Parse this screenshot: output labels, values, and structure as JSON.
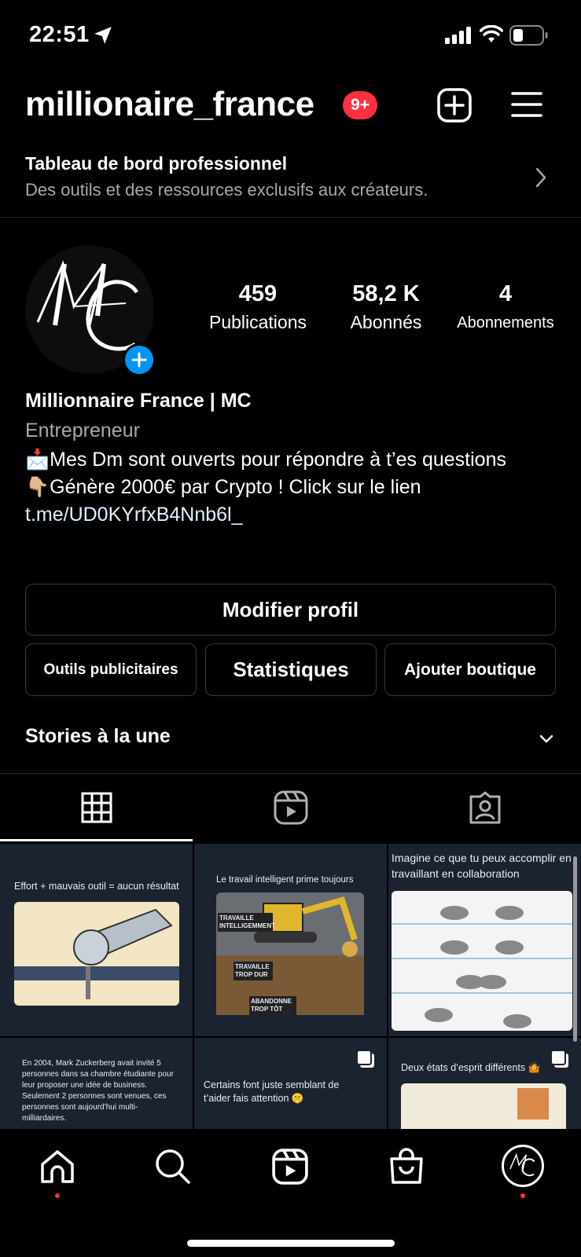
{
  "status_bar": {
    "time": "22:51",
    "icons": [
      "location-arrow-icon",
      "signal-icon",
      "wifi-icon",
      "battery-icon"
    ]
  },
  "header": {
    "username": "millionaire_france",
    "notifications_badge": "9+",
    "icons": [
      "new-post-icon",
      "menu-icon"
    ]
  },
  "dashboard": {
    "title": "Tableau de bord professionnel",
    "subtitle": "Des outils et des ressources exclusifs aux créateurs.",
    "icon": "chevron-right-icon"
  },
  "profile": {
    "avatar_monogram": "MC",
    "stats": [
      {
        "value": "459",
        "label": "Publications"
      },
      {
        "value": "58,2 K",
        "label": "Abonnés"
      },
      {
        "value": "4",
        "label": "Abonnements"
      }
    ],
    "full_name": "Millionnaire France | MC",
    "category": "Entrepreneur",
    "bio_line1": "📩Mes Dm sont ouverts pour répondre à t’es questions",
    "bio_line2": "👇🏼Génère 2000€ par Crypto ! Click sur le lien",
    "bio_link": "t.me/UD0KYrfxB4Nnb6l_"
  },
  "buttons": {
    "edit_profile": "Modifier profil",
    "ad_tools": "Outils publicitaires",
    "insights": "Statistiques",
    "add_shop": "Ajouter boutique"
  },
  "highlights": {
    "title": "Stories à la une",
    "icon": "chevron-down-icon"
  },
  "tabs": [
    {
      "name": "posts-grid",
      "icon": "grid-icon",
      "active": true
    },
    {
      "name": "reels",
      "icon": "reels-icon",
      "active": false
    },
    {
      "name": "tagged",
      "icon": "tagged-icon",
      "active": false
    }
  ],
  "posts": [
    {
      "caption": "Effort + mauvais outil = aucun résultat"
    },
    {
      "caption": "Le travail intelligent prime toujours",
      "labels": [
        "TRAVAILLE INTELLIGEMMENT",
        "TRAVAILLE TROP DUR",
        "ABANDONNE TROP TÔT"
      ]
    },
    {
      "caption": "Imagine ce que tu peux accomplir en travaillant en collaboration"
    },
    {
      "caption": "En 2004, Mark Zuckerberg avait invité 5 personnes dans sa chambre étudiante pour leur proposer une idée de business. Seulement 2 personnes sont venues, ces personnes sont aujourd’hui multi-milliardaires."
    },
    {
      "caption": "Certains font juste semblant de t’aider fais attention 🤫"
    },
    {
      "caption": "Deux états d’esprit différents 🤷"
    }
  ],
  "bottom_nav": [
    "home-icon",
    "search-icon",
    "reels-icon",
    "shop-icon",
    "profile-avatar"
  ],
  "colors": {
    "background": "#000000",
    "badge": "#ff3040",
    "accent_blue": "#0095f6",
    "muted_text": "#a8a8a8",
    "tile_bg": "#1b2330"
  }
}
